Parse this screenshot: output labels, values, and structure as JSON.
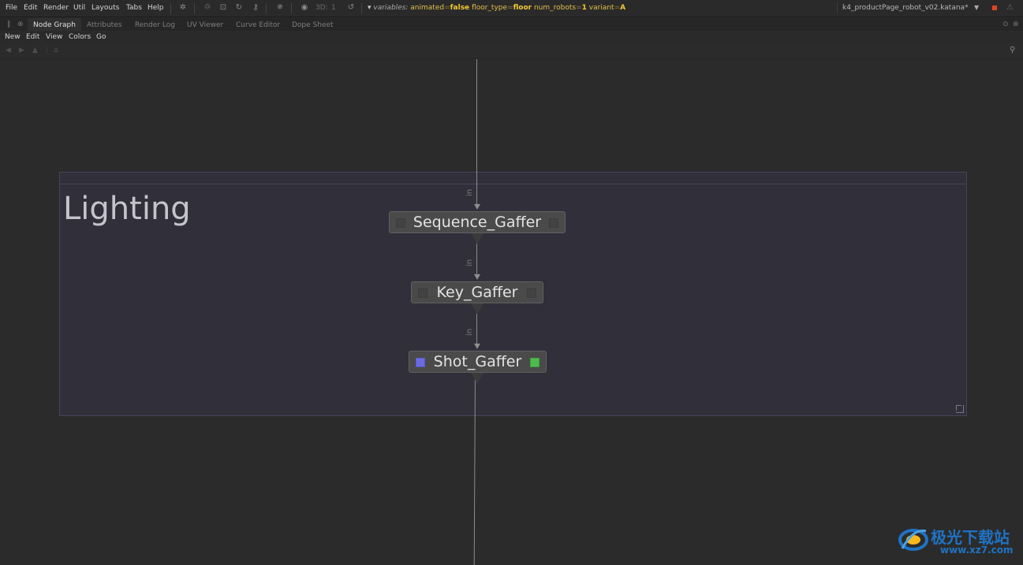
{
  "menubar": {
    "items": [
      "File",
      "Edit",
      "Render",
      "Util",
      "Layouts",
      "Tabs",
      "Help"
    ],
    "three_d_label": "3D:",
    "three_d_value": "1",
    "variables_label": "variables:",
    "variables": [
      {
        "key": "animated",
        "value": "false"
      },
      {
        "key": "floor_type",
        "value": "floor"
      },
      {
        "key": "num_robots",
        "value": "1"
      },
      {
        "key": "variant",
        "value": "A"
      }
    ],
    "project_file": "k4_productPage_robot_v02.katana*",
    "colors": {
      "variable_key": "#e3c04a",
      "variable_value": "#f2c832",
      "stop": "#e0461e"
    }
  },
  "tabs": [
    "Node Graph",
    "Attributes",
    "Render Log",
    "UV Viewer",
    "Curve Editor",
    "Dope Sheet"
  ],
  "active_tab": "Node Graph",
  "panel_menu": [
    "New",
    "Edit",
    "View",
    "Colors",
    "Go"
  ],
  "graph": {
    "backdrop": {
      "title": "Lighting",
      "color": "#302f3a"
    },
    "port_label": "in",
    "nodes": [
      {
        "name": "Sequence_Gaffer"
      },
      {
        "name": "Key_Gaffer"
      },
      {
        "name": "Shot_Gaffer",
        "left_flag_color": "#6c6ae0",
        "right_flag_color": "#4dbb4c"
      }
    ]
  },
  "watermark": {
    "text": "极光下载站",
    "url": "www.xz7.com",
    "color": "#1f73c4"
  }
}
